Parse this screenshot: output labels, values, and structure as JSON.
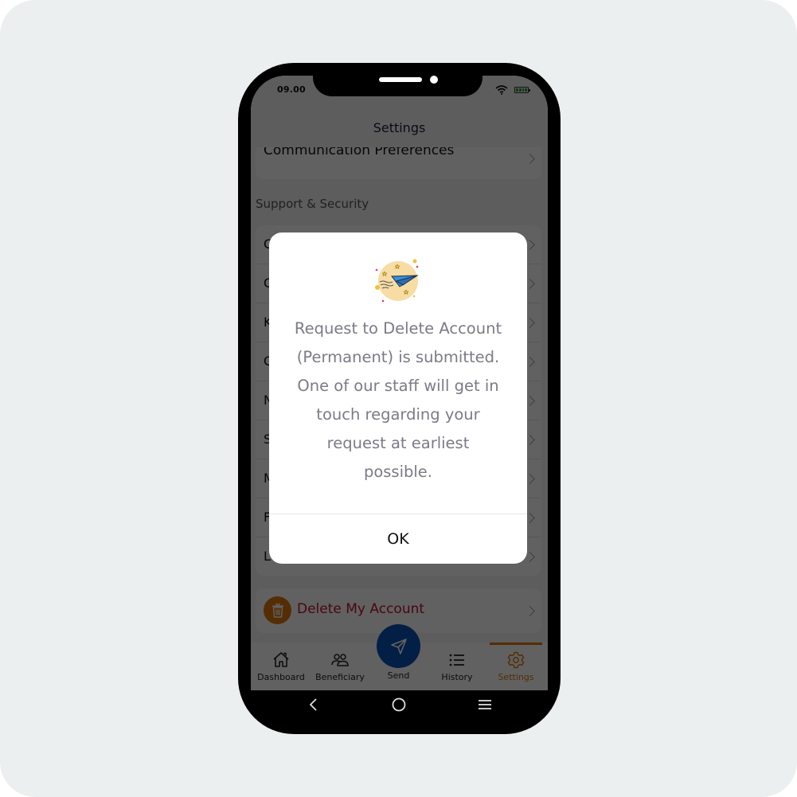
{
  "status_bar": {
    "time": "09.00",
    "wifi_icon": "wifi-icon",
    "battery_icon": "battery-icon"
  },
  "header": {
    "title": "Settings"
  },
  "settings": {
    "communication_label": "Communication Preferences",
    "support_section_title": "Support & Security",
    "support_items": [
      {
        "label": "C"
      },
      {
        "label": "C"
      },
      {
        "label": "K"
      },
      {
        "label": "C"
      },
      {
        "label": "N"
      },
      {
        "label": "S"
      },
      {
        "label": "M"
      },
      {
        "label": "F"
      },
      {
        "label": "L"
      }
    ],
    "delete_account_label": "Delete My Account",
    "delete_icon": "trash-icon"
  },
  "bottom_nav": {
    "items": [
      {
        "label": "Dashboard",
        "icon": "home-icon",
        "active": false
      },
      {
        "label": "Beneficiary",
        "icon": "users-icon",
        "active": false
      },
      {
        "label": "Send",
        "icon": "paper-plane-icon",
        "active": false
      },
      {
        "label": "History",
        "icon": "list-icon",
        "active": false
      },
      {
        "label": "Settings",
        "icon": "gear-icon",
        "active": true
      }
    ]
  },
  "modal": {
    "illustration": "paper-plane-illustration",
    "message_lines": [
      "Request to Delete Account",
      "(Permanent) is submitted.",
      "One of our staff will get in",
      "touch regarding your",
      "request at earliest",
      "possible."
    ],
    "ok_label": "OK"
  },
  "system_nav": {
    "back_icon": "back-icon",
    "home_icon": "home-circle-icon",
    "recents_icon": "menu-icon"
  },
  "colors": {
    "accent_orange": "#e0770e",
    "send_blue": "#0a52b8",
    "delete_red": "#c0102f",
    "modal_text": "#7c7a86",
    "battery_green": "#2e9a3a"
  }
}
